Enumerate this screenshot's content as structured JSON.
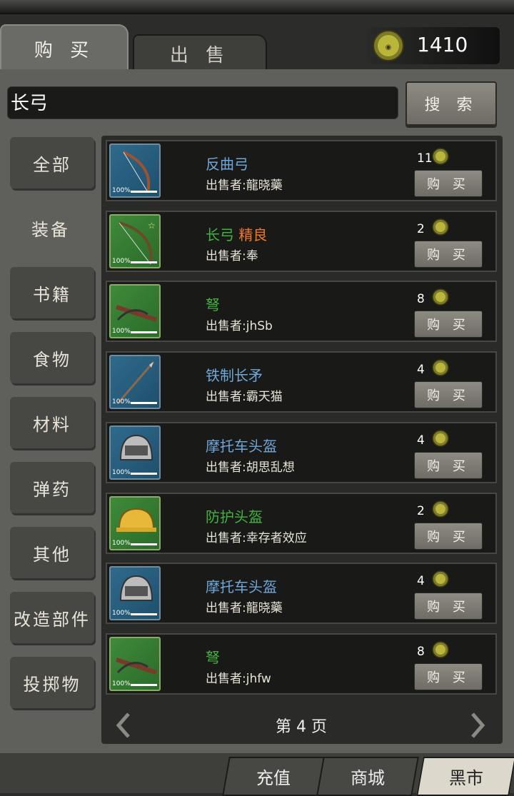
{
  "tabs": {
    "buy": "购 买",
    "sell": "出 售"
  },
  "currency": {
    "amount": "1410",
    "color": "#b9b63a"
  },
  "search": {
    "value": "长弓",
    "button": "搜 索"
  },
  "categories": [
    "全部",
    "装备",
    "书籍",
    "食物",
    "材料",
    "弹药",
    "其他",
    "改造部件",
    "投掷物"
  ],
  "active_category": "装备",
  "items": [
    {
      "name": "反曲弓",
      "quality": "",
      "seller": "出售者:龍晓藥",
      "price": "11",
      "icon": "bow-icon",
      "bg": "blue",
      "color": "#6ea8d8",
      "durability": "100%"
    },
    {
      "name": "长弓",
      "quality": "精良",
      "seller": "出售者:奉",
      "price": "2",
      "icon": "longbow-icon",
      "bg": "green",
      "color": "#3fb53a",
      "durability": "100%"
    },
    {
      "name": "弩",
      "quality": "",
      "seller": "出售者:jhSb",
      "price": "8",
      "icon": "crossbow-icon",
      "bg": "green",
      "color": "#3fb53a",
      "durability": "100%"
    },
    {
      "name": "铁制长矛",
      "quality": "",
      "seller": "出售者:霸天猫",
      "price": "4",
      "icon": "spear-icon",
      "bg": "blue",
      "color": "#6ea8d8",
      "durability": "100%"
    },
    {
      "name": "摩托车头盔",
      "quality": "",
      "seller": "出售者:胡思乱想",
      "price": "4",
      "icon": "helmet-icon",
      "bg": "blue",
      "color": "#6ea8d8",
      "durability": "100%"
    },
    {
      "name": "防护头盔",
      "quality": "",
      "seller": "出售者:幸存者效应",
      "price": "2",
      "icon": "hardhat-icon",
      "bg": "green",
      "color": "#3fb53a",
      "durability": "100%"
    },
    {
      "name": "摩托车头盔",
      "quality": "",
      "seller": "出售者:龍晓藥",
      "price": "4",
      "icon": "helmet-icon",
      "bg": "blue",
      "color": "#6ea8d8",
      "durability": "100%"
    },
    {
      "name": "弩",
      "quality": "",
      "seller": "出售者:jhfw",
      "price": "8",
      "icon": "crossbow-icon",
      "bg": "green",
      "color": "#3fb53a",
      "durability": "100%"
    }
  ],
  "buy_label": "购 买",
  "quality_color": "#f07a1a",
  "pager": {
    "label": "第 4 页"
  },
  "bottom_tabs": [
    "充值",
    "商城",
    "黑市"
  ],
  "active_bottom_tab": "黑市"
}
